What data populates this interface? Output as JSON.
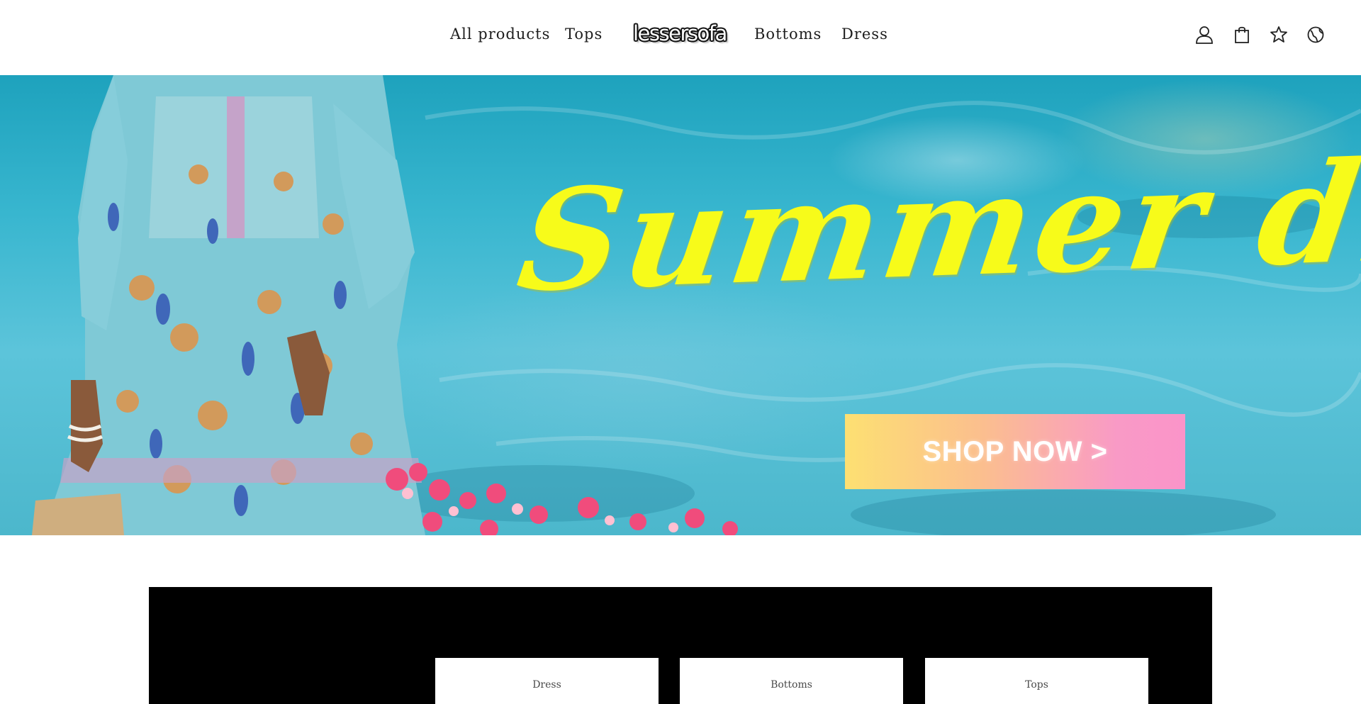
{
  "header": {
    "nav_left": [
      "All products",
      "Tops"
    ],
    "logo": "lessersofa",
    "nav_right": [
      "Bottoms",
      "Dress"
    ],
    "icons": [
      "account-icon",
      "cart-icon",
      "star-icon",
      "language-icon"
    ]
  },
  "hero": {
    "headline": "Summer discou",
    "cta_label": "SHOP NOW >",
    "colors": {
      "headline": "#f7fb1a",
      "cta_from": "#fde072",
      "cta_to": "#fa94c9",
      "water": "#38b6cf"
    }
  },
  "categories": {
    "cards": [
      "Dress",
      "Bottoms",
      "Tops"
    ]
  }
}
